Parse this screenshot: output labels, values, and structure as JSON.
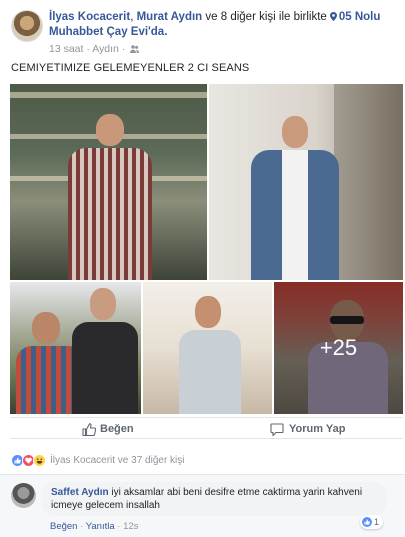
{
  "post": {
    "author": "İlyas Kocacerit",
    "with_prefix": ",",
    "tagged_first": "Murat Aydın",
    "tagged_rest_text": "ve 8 diğer kişi ile birlikte",
    "location": "05 Nolu Muhabbet Çay Evi'da.",
    "time": "13 saat",
    "meta_sep": "·",
    "place": "Aydın",
    "meta_sep2": "·",
    "text": "CEMIYETIMIZE GELEMEYENLER 2 CI SEANS",
    "more_photos": "+25"
  },
  "actions": {
    "like_label": "Beğen",
    "comment_label": "Yorum Yap"
  },
  "reactions": {
    "summary": "İlyas Kocacerit ve 37 diğer kişi"
  },
  "comment": {
    "author": "Saffet Aydın",
    "text": "iyi aksamlar abi beni desifre etme caktirma yarin kahveni icmeye gelecem insallah",
    "likes": "1",
    "like_link": "Beğen",
    "dot1": "·",
    "reply_link": "Yanıtla",
    "dot2": "·",
    "time": "12s"
  },
  "colors": {
    "link_blue": "#365899",
    "meta_gray": "#90949c",
    "like_blue": "#5890ff",
    "love_red": "#f25268",
    "haha_yellow": "#fcd34a"
  },
  "icons": [
    "location-pin-icon",
    "friends-icon",
    "thumbs-up-icon",
    "comment-icon",
    "like-reaction-icon",
    "love-reaction-icon",
    "haha-reaction-icon"
  ]
}
